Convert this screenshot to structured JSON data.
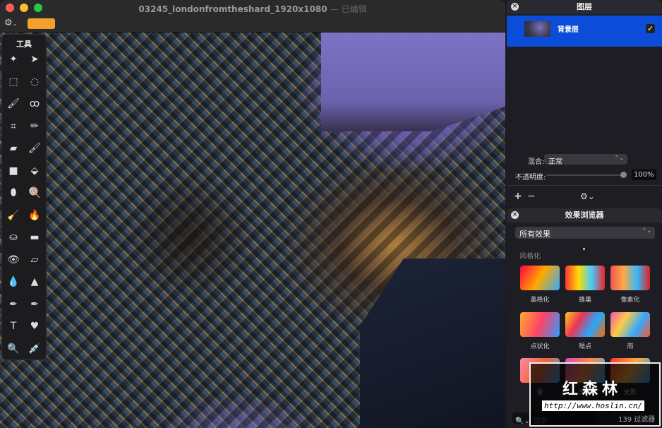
{
  "window": {
    "title": "03245_londonfromtheshard_1920x1080",
    "edited": "— 已编辑"
  },
  "toolbar": {
    "gear": "⚙",
    "chevron": "⌄",
    "color": "#f6a02c"
  },
  "tools": {
    "title": "工具",
    "items": [
      [
        "magic-wand",
        "✦"
      ],
      [
        "pointer",
        "➤"
      ],
      [
        "rect-select",
        "⬚"
      ],
      [
        "ellipse-select",
        "◌"
      ],
      [
        "color-select",
        "🖌"
      ],
      [
        "lasso",
        "ꝏ"
      ],
      [
        "crop",
        "⌗"
      ],
      [
        "pencil",
        "✏"
      ],
      [
        "eraser",
        "▰"
      ],
      [
        "brush",
        "🖌"
      ],
      [
        "rectangle",
        "■"
      ],
      [
        "bucket",
        "⬙"
      ],
      [
        "gradient",
        "⬮"
      ],
      [
        "color-picker-lollipop",
        "🍭"
      ],
      [
        "smudge",
        "🧹"
      ],
      [
        "burn",
        "🔥"
      ],
      [
        "clone-stamp",
        "⛀"
      ],
      [
        "bandage",
        "▬"
      ],
      [
        "red-eye",
        "👁"
      ],
      [
        "eraser-2",
        "▱"
      ],
      [
        "blur",
        "💧"
      ],
      [
        "sharpen",
        "▲"
      ],
      [
        "pen",
        "✒"
      ],
      [
        "freeform-pen",
        "✒"
      ],
      [
        "text",
        "T"
      ],
      [
        "shape-heart",
        "♥"
      ],
      [
        "zoom",
        "🔍"
      ],
      [
        "eyedropper",
        "💉"
      ]
    ]
  },
  "layers": {
    "title": "图层",
    "layer_name": "背景层",
    "checked": "✓",
    "blend_label": "混合:",
    "blend_value": "正常",
    "opacity_label": "不透明度:",
    "opacity_value": "100%",
    "opacity": 1.0,
    "add": "+",
    "remove": "−",
    "gear": "⚙⌄"
  },
  "effects": {
    "title": "效果浏览器",
    "filter": "所有效果",
    "category": "风格化",
    "items": [
      "晶格化",
      "蜂巢",
      "像素化",
      "点状化",
      "噪点",
      "雨",
      "雪",
      "渐变",
      "光影"
    ],
    "search_placeholder": "搜索",
    "count": "139 过滤器"
  },
  "watermark": {
    "text": "红森林",
    "url": "http://www.hoslin.cn/"
  }
}
